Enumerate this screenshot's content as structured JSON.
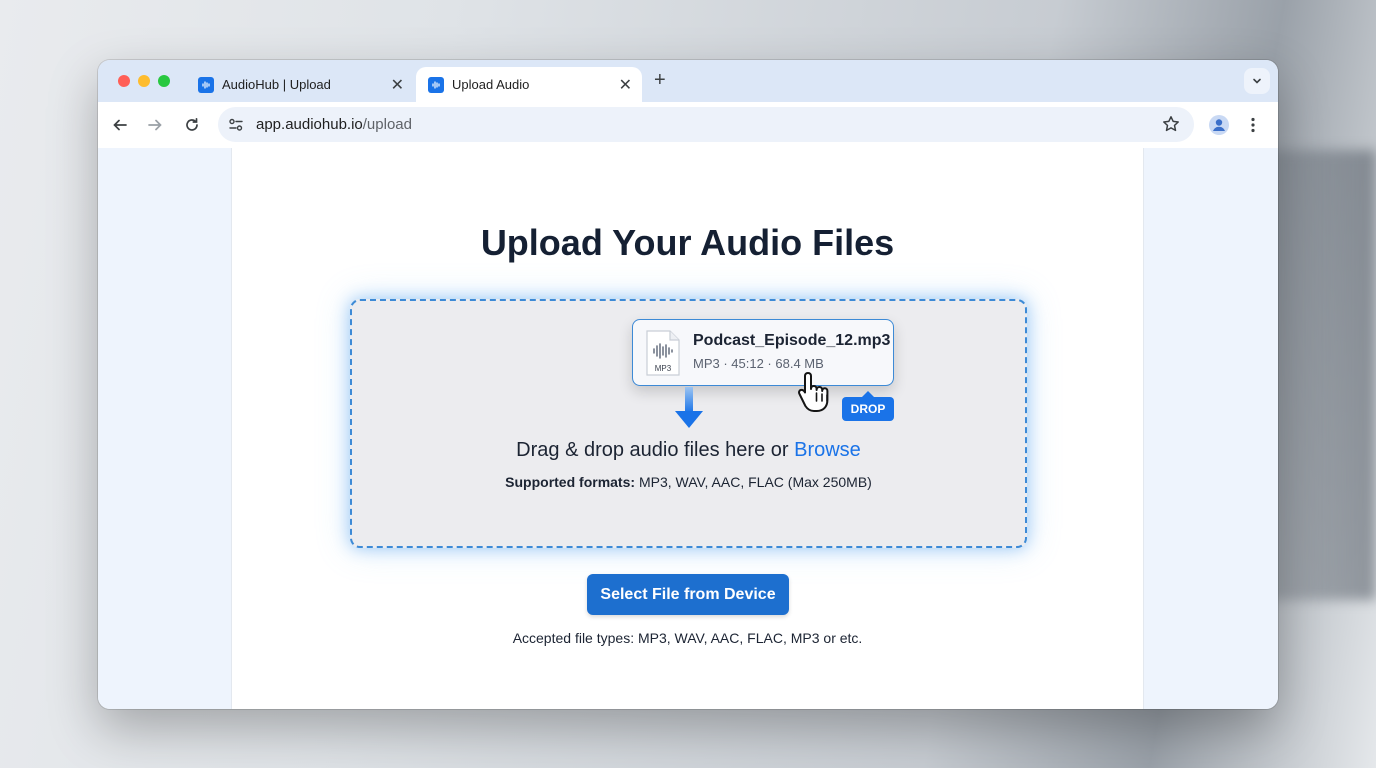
{
  "browser": {
    "tabs": [
      {
        "title": "AudioHub | Upload",
        "active": false
      },
      {
        "title": "Upload Audio",
        "active": true
      }
    ],
    "url_host": "app.audiohub.io",
    "url_path": "/upload"
  },
  "page": {
    "title": "Upload Your Audio Files",
    "dragged_file": {
      "name": "Podcast_Episode_12.mp3",
      "meta": "MP3 · 45:12 · 68.4 MB",
      "icon_label": "MP3"
    },
    "drop_badge": "DROP",
    "dropzone_text": "Drag & drop audio files here or",
    "browse_link": "Browse",
    "formats_label": "Supported formats:",
    "formats_value": "MP3, WAV, AAC, FLAC (Max 250MB)",
    "select_button": "Select File from Device",
    "accepted_text": "Accepted file types: MP3, WAV, AAC, FLAC, MP3 or etc."
  },
  "colors": {
    "accent": "#1a73e8",
    "button": "#1d6fcf",
    "dropzone_border": "#3d8ad6"
  }
}
